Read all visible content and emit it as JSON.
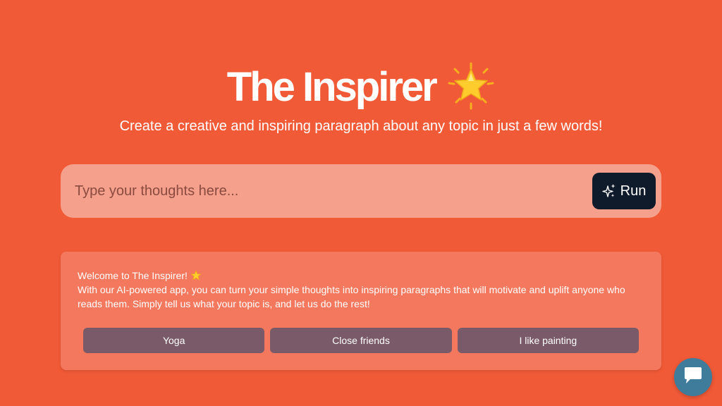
{
  "header": {
    "title": "The Inspirer",
    "title_icon": "glowing-star-emoji",
    "subtitle": "Create a creative and inspiring paragraph about any topic in just a few words!"
  },
  "prompt": {
    "placeholder": "Type your thoughts here...",
    "value": "",
    "run_label": "Run",
    "run_icon": "sparkles-icon"
  },
  "welcome": {
    "heading": "Welcome to The Inspirer!",
    "heading_icon": "glowing-star-emoji",
    "body": "With our AI-powered app, you can turn your simple thoughts into inspiring paragraphs that will motivate and uplift anyone who reads them. Simply tell us what your topic is, and let us do the rest!",
    "suggestions": [
      {
        "label": "Yoga"
      },
      {
        "label": "Close friends"
      },
      {
        "label": "I like painting"
      }
    ]
  },
  "chat_widget": {
    "icon": "chat-bubble-icon"
  },
  "colors": {
    "background": "#f15a37",
    "input_bg": "#f5a08c",
    "run_button_bg": "#0f1a2a",
    "card_bg": "#f3785d",
    "chip_bg": "#7a5a68",
    "chat_widget_bg": "#3f7c9c"
  }
}
